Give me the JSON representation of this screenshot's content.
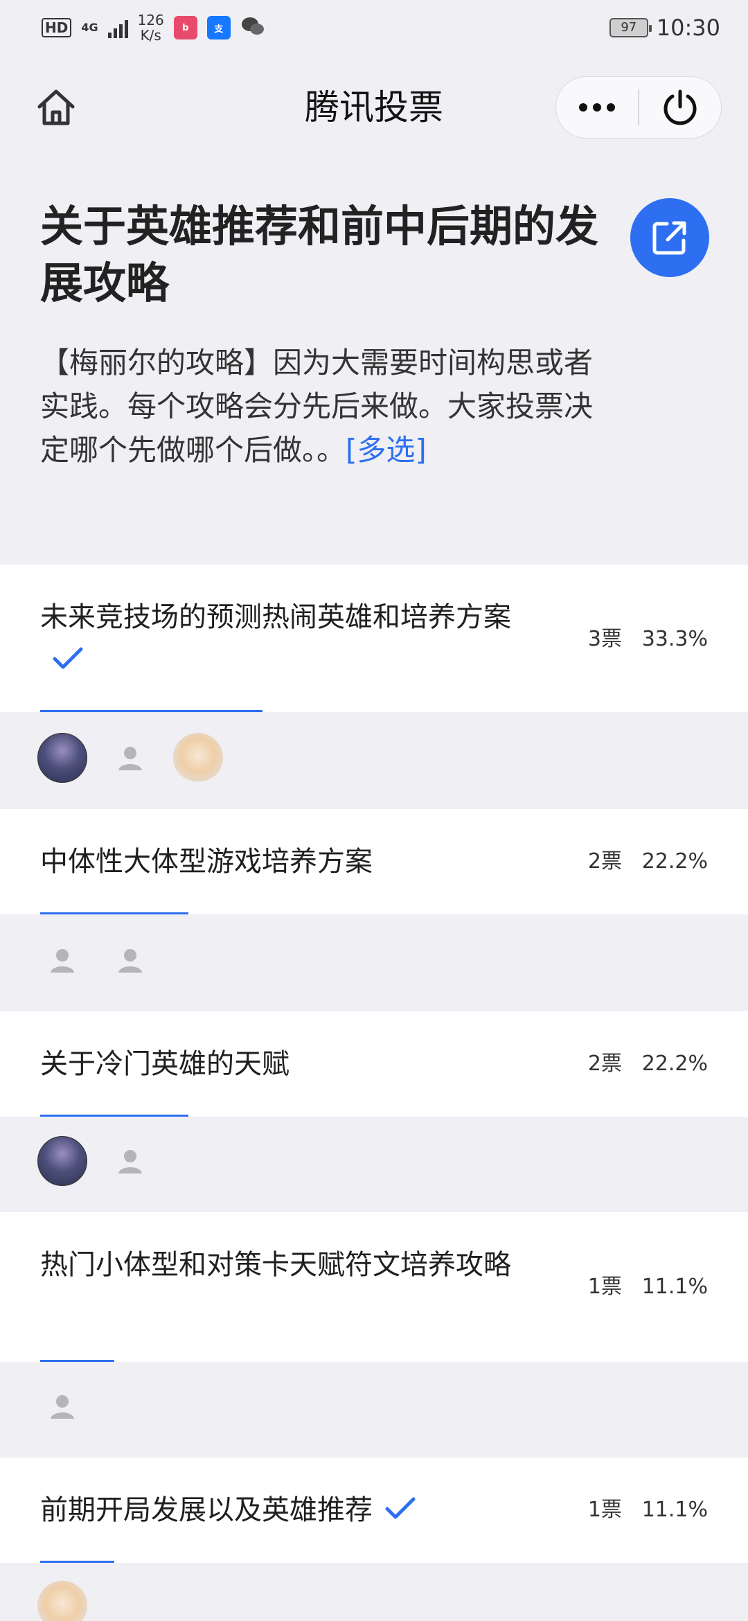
{
  "status_bar": {
    "hd": "HD",
    "network": "4G",
    "speed_value": "126",
    "speed_unit": "K/s",
    "battery": "97",
    "time": "10:30"
  },
  "nav": {
    "title": "腾讯投票"
  },
  "poll": {
    "title": "关于英雄推荐和前中后期的发展攻略",
    "description": "【梅丽尔的攻略】因为大需要时间构思或者实践。每个攻略会分先后来做。大家投票决定哪个先做哪个后做。。",
    "multi_tag": "[多选]"
  },
  "options": [
    {
      "text": "未来竞技场的预测热闹英雄和培养方案",
      "votes": "3票",
      "percent": "33.3%",
      "ratio": 0.333,
      "checked": true
    },
    {
      "text": "中体性大体型游戏培养方案",
      "votes": "2票",
      "percent": "22.2%",
      "ratio": 0.222,
      "checked": false
    },
    {
      "text": "关于冷门英雄的天赋",
      "votes": "2票",
      "percent": "22.2%",
      "ratio": 0.222,
      "checked": false
    },
    {
      "text": "热门小体型和对策卡天赋符文培养攻略",
      "votes": "1票",
      "percent": "11.1%",
      "ratio": 0.111,
      "checked": false
    },
    {
      "text": "前期开局发展以及英雄推荐",
      "votes": "1票",
      "percent": "11.1%",
      "ratio": 0.111,
      "checked": true
    }
  ],
  "colors": {
    "accent": "#2d6ff0",
    "background": "#efeff4"
  },
  "icons": [
    "home-icon",
    "more-dots-icon",
    "power-icon",
    "share-external-icon",
    "checkmark-icon",
    "default-avatar-icon"
  ]
}
